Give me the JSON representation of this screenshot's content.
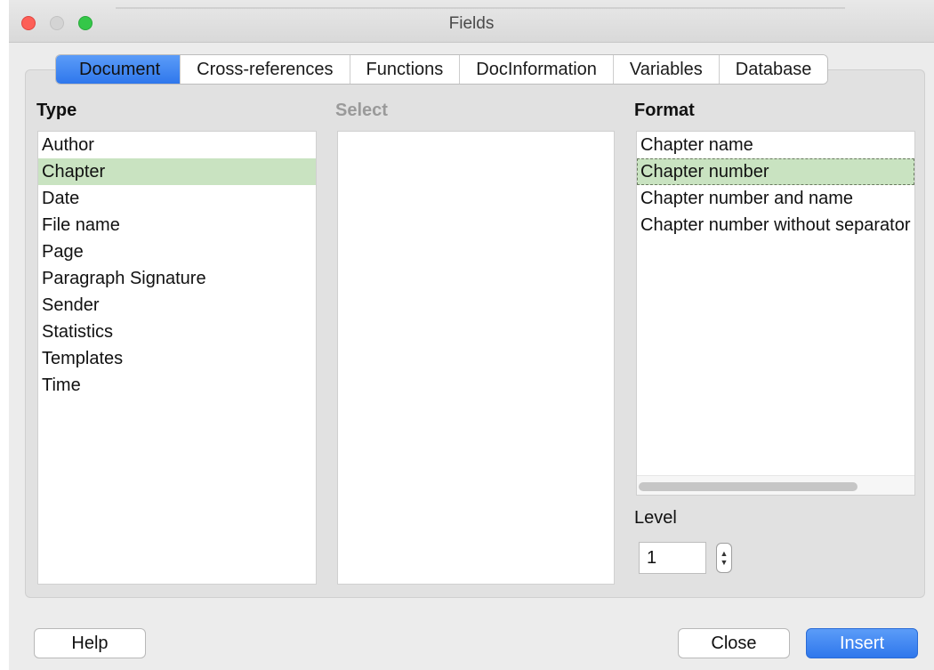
{
  "window": {
    "title": "Fields"
  },
  "tabs": [
    {
      "label": "Document",
      "active": true
    },
    {
      "label": "Cross-references",
      "active": false
    },
    {
      "label": "Functions",
      "active": false
    },
    {
      "label": "DocInformation",
      "active": false
    },
    {
      "label": "Variables",
      "active": false
    },
    {
      "label": "Database",
      "active": false
    }
  ],
  "type_column": {
    "label": "Type",
    "items": [
      "Author",
      "Chapter",
      "Date",
      "File name",
      "Page",
      "Paragraph Signature",
      "Sender",
      "Statistics",
      "Templates",
      "Time"
    ],
    "selected": "Chapter"
  },
  "select_column": {
    "label": "Select",
    "items": []
  },
  "format_column": {
    "label": "Format",
    "items": [
      "Chapter name",
      "Chapter number",
      "Chapter number and name",
      "Chapter number without separator"
    ],
    "selected": "Chapter number"
  },
  "level": {
    "label": "Level",
    "value": "1"
  },
  "buttons": {
    "help": "Help",
    "close": "Close",
    "insert": "Insert"
  },
  "colors": {
    "accent": "#2f77ec",
    "selection": "#c9e3c1"
  }
}
